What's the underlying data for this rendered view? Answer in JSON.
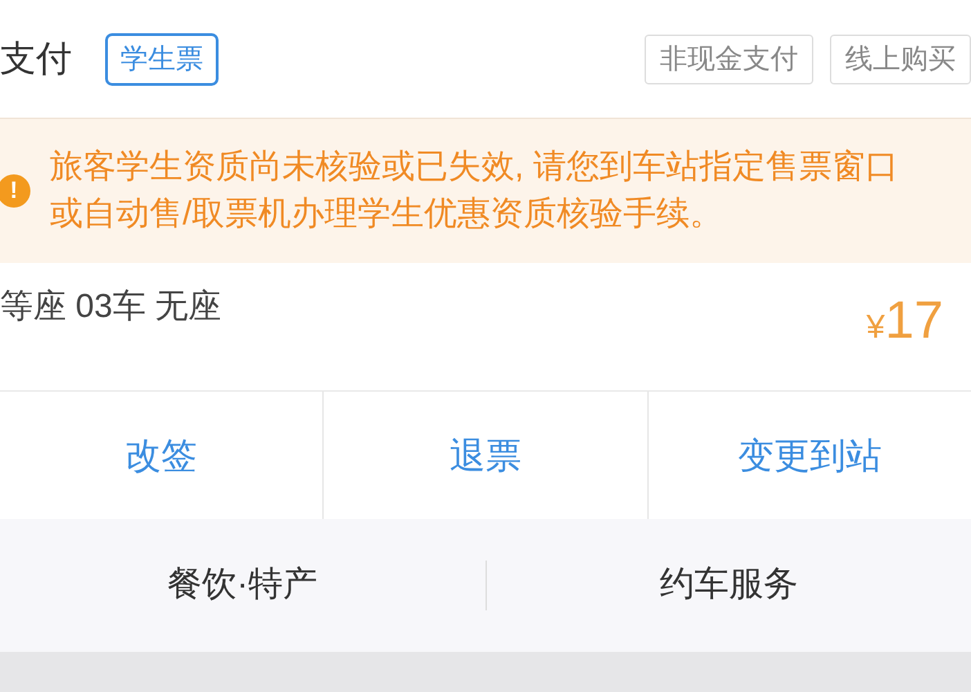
{
  "header": {
    "payment": "支付",
    "ticket_tag": "学生票",
    "tags": [
      "非现金支付",
      "线上购买"
    ]
  },
  "warning": {
    "icon": "!",
    "message": "旅客学生资质尚未核验或已失效, 请您到车站指定售票窗口或自动售/取票机办理学生优惠资质核验手续。"
  },
  "seat": {
    "info": "等座 03车 无座",
    "currency": "¥",
    "price": "17"
  },
  "actions": [
    "改签",
    "退票",
    "变更到站"
  ],
  "services": [
    "餐饮·特产",
    "约车服务"
  ]
}
